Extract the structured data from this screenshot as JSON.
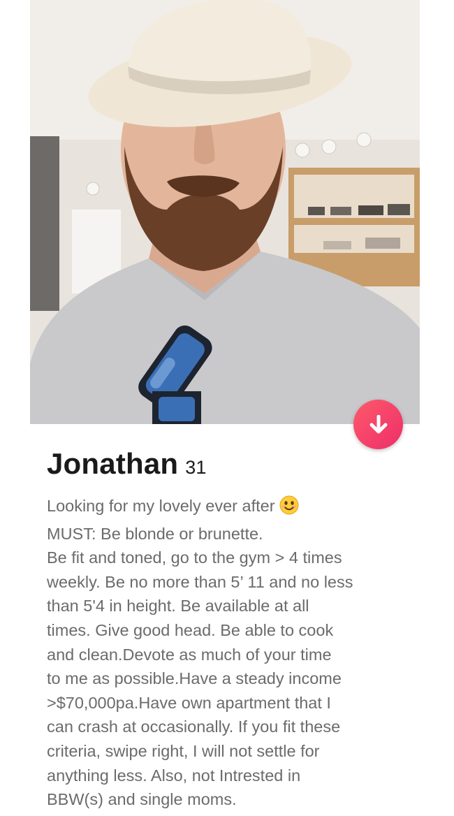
{
  "profile": {
    "name": "Jonathan",
    "age": "31",
    "bio_lines": [
      "Looking  for my lovely ever after",
      "MUST: Be blonde or brunette.",
      "Be fit and toned, go to the gym > 4 times",
      "weekly. Be no more than 5’ 11 and no less",
      "than 5'4 in height. Be available at all",
      "times. Give good head. Be able to cook",
      "and clean.Devote as much of your time",
      "to me as possible.Have a steady income",
      ">$70,000pa.Have own apartment that I",
      "can crash at occasionally. If you fit these",
      "criteria, swipe right, I will not settle for",
      "anything less. Also, not Intrested in",
      "BBW(s) and single moms."
    ],
    "bio_emoji": "smiling-face-emoji"
  },
  "actions": {
    "collapse_icon": "arrow-down-icon",
    "accent_color": "#f43f6a"
  }
}
